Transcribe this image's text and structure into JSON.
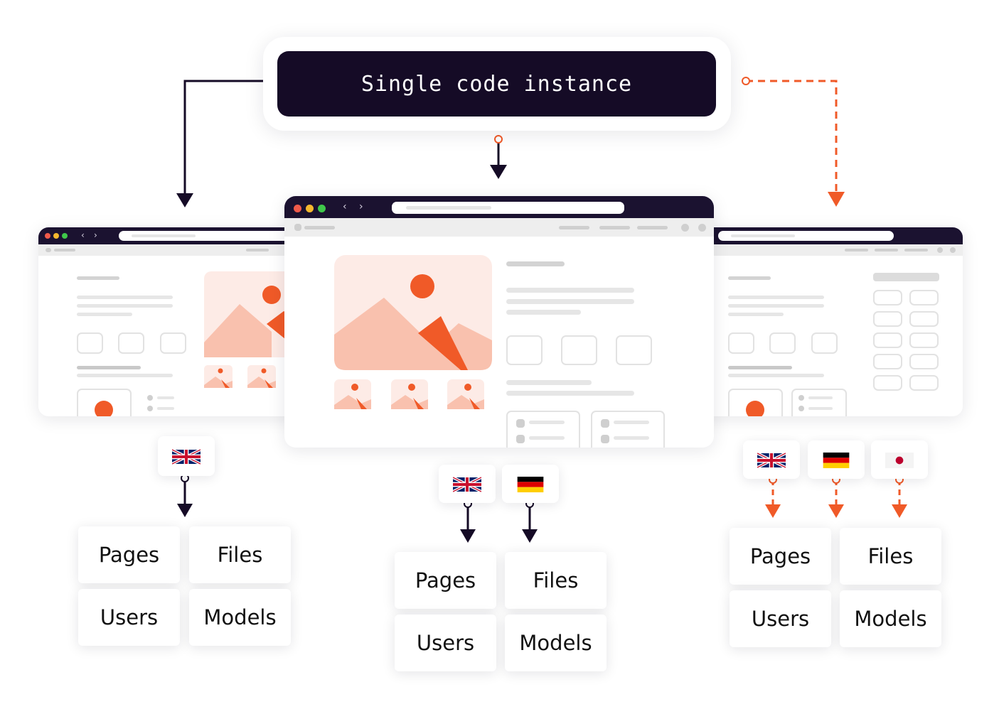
{
  "header": {
    "title": "Single code instance"
  },
  "colors": {
    "dark": "#150b26",
    "accent": "#f05a28",
    "pink": "#fdebe6",
    "salmon": "#f9c1ae"
  },
  "groups": [
    {
      "languages": [
        "en"
      ],
      "tiles": [
        "Pages",
        "Files",
        "Users",
        "Models"
      ]
    },
    {
      "languages": [
        "en",
        "de"
      ],
      "tiles": [
        "Pages",
        "Files",
        "Users",
        "Models"
      ]
    },
    {
      "languages": [
        "en",
        "de",
        "ja"
      ],
      "tiles": [
        "Pages",
        "Files",
        "Users",
        "Models"
      ]
    }
  ],
  "icons": [
    "window-close-dot-icon",
    "window-minimize-dot-icon",
    "window-maximize-dot-icon",
    "chevron-left-icon",
    "chevron-right-icon",
    "image-placeholder-icon",
    "play-icon",
    "uk-flag-icon",
    "germany-flag-icon",
    "japan-flag-icon",
    "arrow-down-icon"
  ]
}
